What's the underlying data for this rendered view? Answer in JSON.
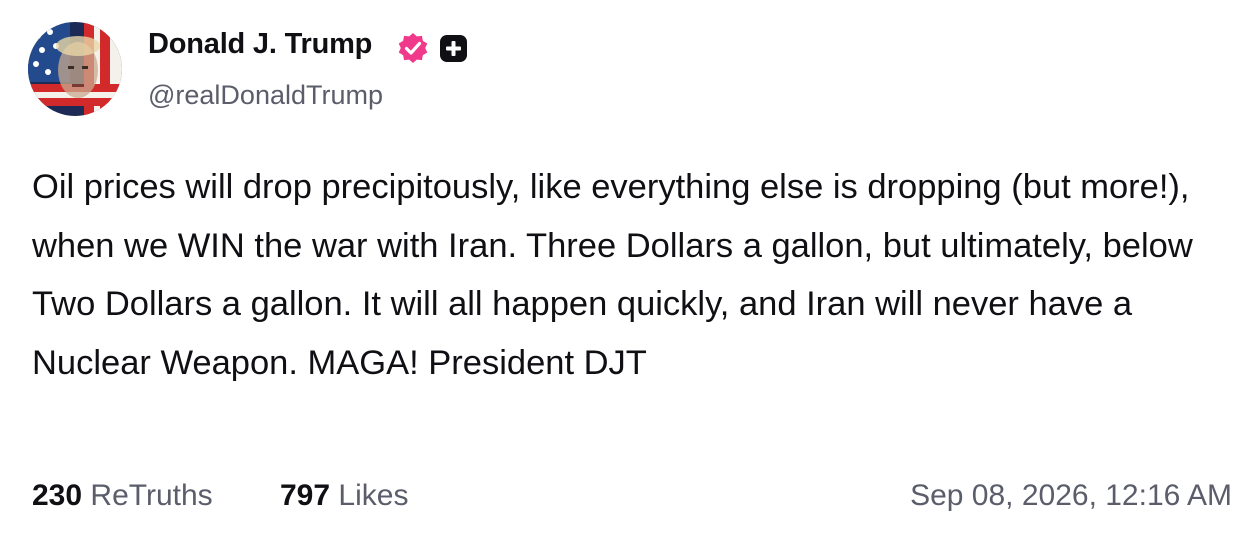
{
  "author": {
    "display_name": "Donald J. Trump",
    "handle": "@realDonaldTrump",
    "verified_icon": "verified-badge-icon",
    "badge_color": "#f0398a",
    "plus_icon": "plus-badge-icon"
  },
  "post": {
    "text": "Oil prices will drop precipitously, like everything else is dropping (but more!), when we WIN the war with Iran. Three Dollars a gallon, but ultimately, below Two Dollars a gallon. It will all happen quickly, and Iran will never have a Nuclear Weapon. MAGA! President DJT"
  },
  "stats": {
    "retruths_count": "230",
    "retruths_label": "ReTruths",
    "likes_count": "797",
    "likes_label": "Likes"
  },
  "timestamp": "Sep 08, 2026, 12:16 AM"
}
